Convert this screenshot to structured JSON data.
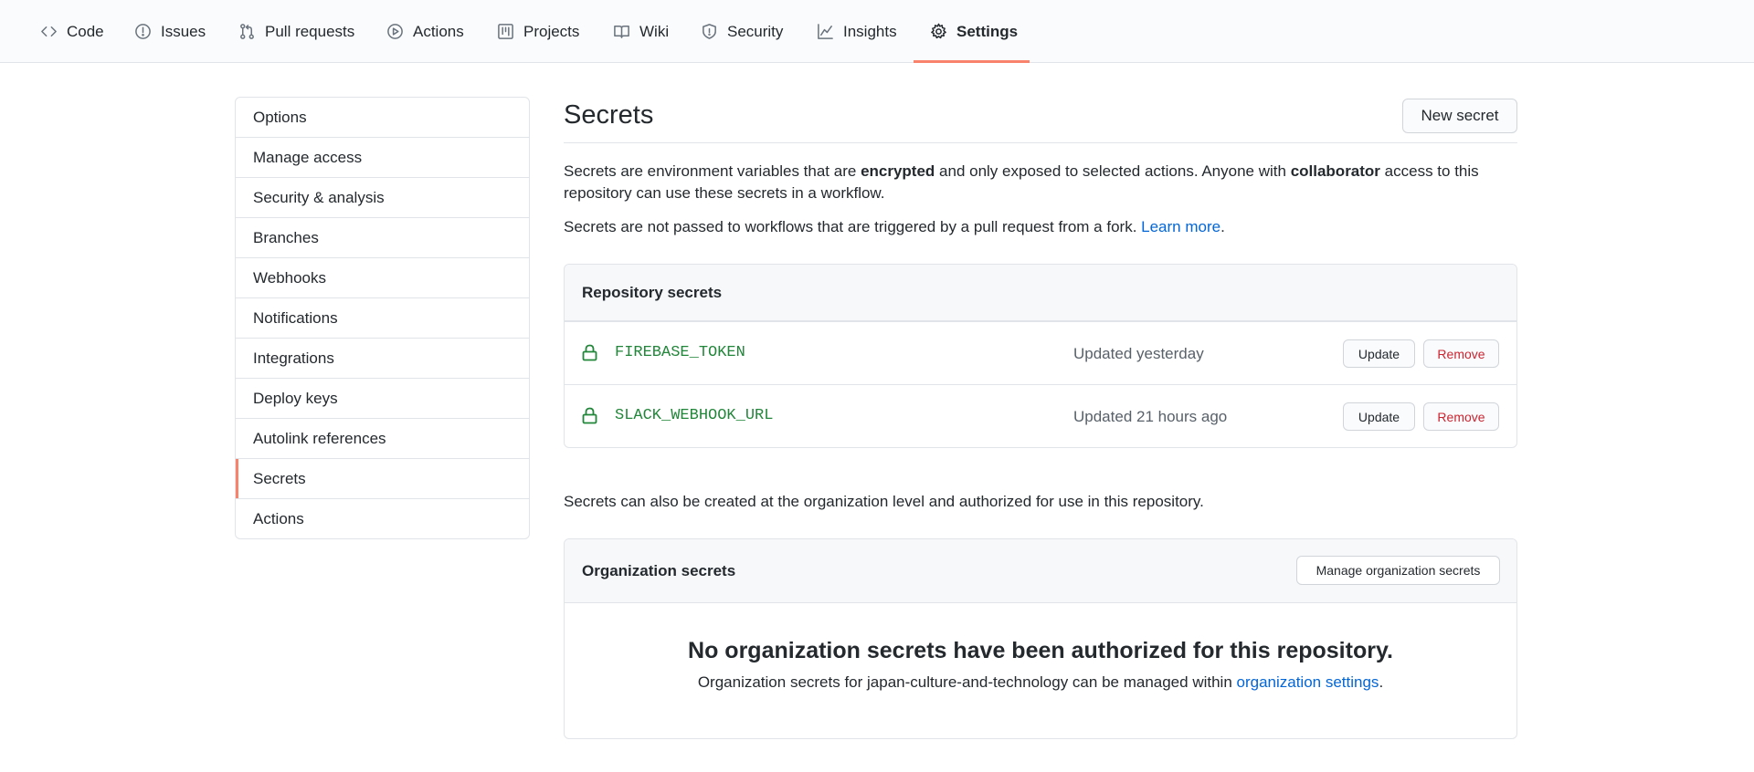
{
  "nav": {
    "tabs": [
      {
        "label": "Code",
        "icon": "code-icon"
      },
      {
        "label": "Issues",
        "icon": "issue-icon"
      },
      {
        "label": "Pull requests",
        "icon": "pull-request-icon"
      },
      {
        "label": "Actions",
        "icon": "play-icon"
      },
      {
        "label": "Projects",
        "icon": "project-icon"
      },
      {
        "label": "Wiki",
        "icon": "book-icon"
      },
      {
        "label": "Security",
        "icon": "shield-icon"
      },
      {
        "label": "Insights",
        "icon": "graph-icon"
      },
      {
        "label": "Settings",
        "icon": "gear-icon"
      }
    ],
    "active": "Settings",
    "accent": "#f9826c"
  },
  "sidebar": {
    "items": [
      {
        "label": "Options"
      },
      {
        "label": "Manage access"
      },
      {
        "label": "Security & analysis"
      },
      {
        "label": "Branches"
      },
      {
        "label": "Webhooks"
      },
      {
        "label": "Notifications"
      },
      {
        "label": "Integrations"
      },
      {
        "label": "Deploy keys"
      },
      {
        "label": "Autolink references"
      },
      {
        "label": "Secrets"
      },
      {
        "label": "Actions"
      }
    ],
    "active": "Secrets"
  },
  "main": {
    "title": "Secrets",
    "new_button": "New secret",
    "intro": {
      "t1": "Secrets are environment variables that are ",
      "b1": "encrypted",
      "t2": " and only exposed to selected actions. Anyone with ",
      "b2": "collaborator",
      "t3": " access to this repository can use these secrets in a workflow."
    },
    "fork_note": {
      "text": "Secrets are not passed to workflows that are triggered by a pull request from a fork. ",
      "link": "Learn more",
      "end": "."
    },
    "repo_secrets": {
      "header": "Repository secrets",
      "update_label": "Update",
      "remove_label": "Remove",
      "rows": [
        {
          "name": "FIREBASE_TOKEN",
          "updated": "Updated yesterday"
        },
        {
          "name": "SLACK_WEBHOOK_URL",
          "updated": "Updated 21 hours ago"
        }
      ]
    },
    "org_note": "Secrets can also be created at the organization level and authorized for use in this repository.",
    "org_secrets": {
      "header": "Organization secrets",
      "manage_button": "Manage organization secrets",
      "empty_title": "No organization secrets have been authorized for this repository.",
      "empty_text": "Organization secrets for japan-culture-and-technology can be managed within ",
      "empty_link": "organization settings",
      "empty_end": "."
    }
  },
  "colors": {
    "link": "#0366d6",
    "secret_name": "#22863a",
    "remove": "#cb2431"
  }
}
